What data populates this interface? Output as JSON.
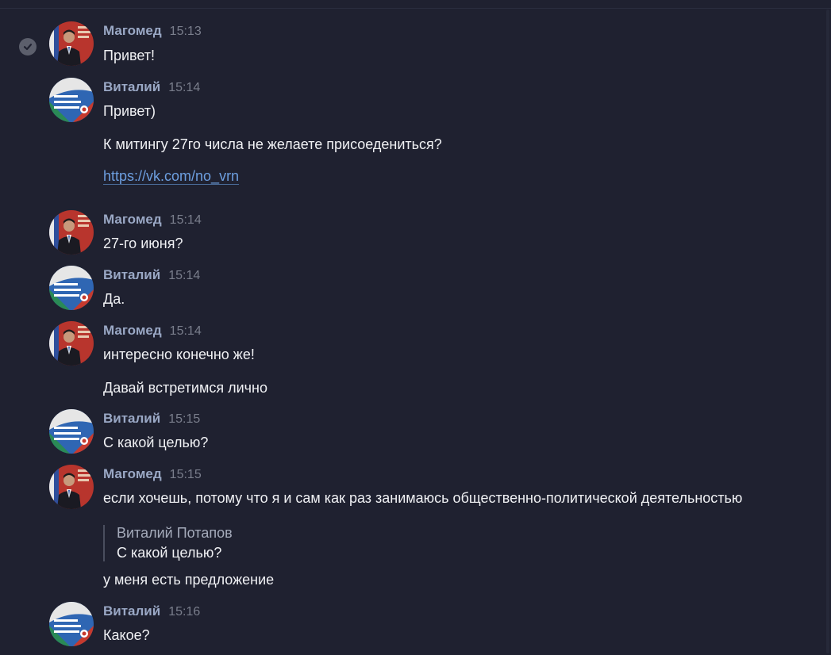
{
  "colors": {
    "background": "#1f2130",
    "author": "#9aa8c5",
    "timestamp": "#7a7e8c",
    "text": "#f0f1f4",
    "link": "#6d9fe0",
    "quote_bar": "#4a4e5e"
  },
  "icons": {
    "read_check": "check-circle-icon"
  },
  "messages": [
    {
      "author": "Магомед",
      "time": "15:13",
      "lines": [
        "Привет!"
      ]
    },
    {
      "author": "Виталий",
      "time": "15:14",
      "lines": [
        "Привет)",
        "К митингу 27го числа не желаете присоедениться?"
      ],
      "link": "https://vk.com/no_vrn"
    },
    {
      "author": "Магомед",
      "time": "15:14",
      "lines": [
        "27-го июня?"
      ]
    },
    {
      "author": "Виталий",
      "time": "15:14",
      "lines": [
        "Да."
      ]
    },
    {
      "author": "Магомед",
      "time": "15:14",
      "lines": [
        "интересно конечно же!",
        "Давай встретимся лично"
      ]
    },
    {
      "author": "Виталий",
      "time": "15:15",
      "lines": [
        "С какой целью?"
      ]
    },
    {
      "author": "Магомед",
      "time": "15:15",
      "lines": [
        "если хочешь, потому что я и сам как раз занимаюсь общественно-политической деятельностью",
        "у меня есть предложение"
      ],
      "quote": {
        "author": "Виталий Потапов",
        "text": "С какой целью?"
      }
    },
    {
      "author": "Виталий",
      "time": "15:16",
      "lines": [
        "Какое?"
      ]
    }
  ]
}
